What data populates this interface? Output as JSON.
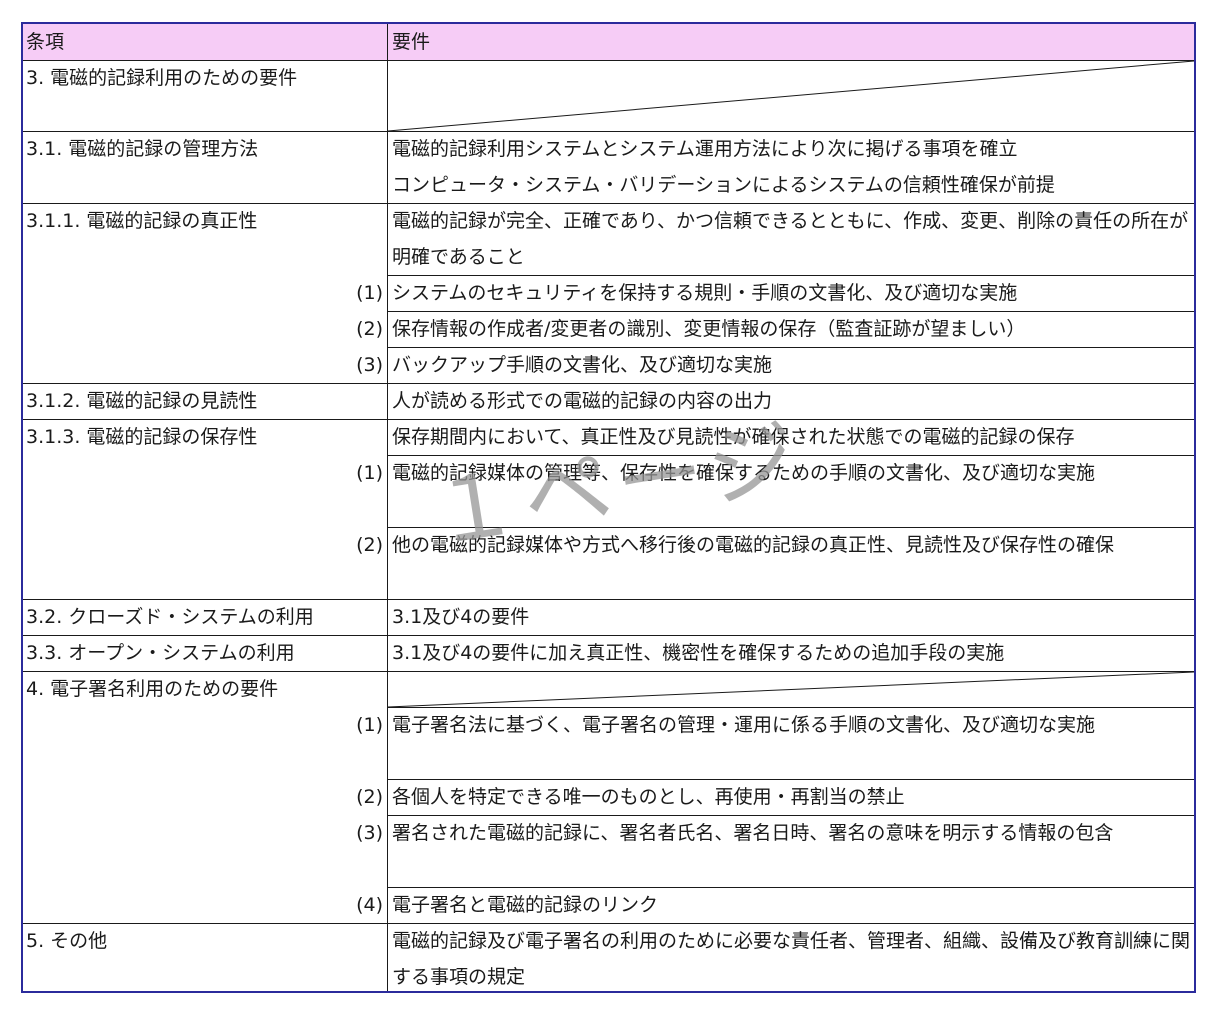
{
  "header": {
    "clause": "条項",
    "requirement": "要件"
  },
  "rows": {
    "r3": {
      "clause": "3. 電磁的記録利用のための要件"
    },
    "r31": {
      "clause": "3.1. 電磁的記録の管理方法",
      "line1": "電磁的記録利用システムとシステム運用方法により次に掲げる事項を確立",
      "line2": "コンピュータ・システム・バリデーションによるシステムの信頼性確保が前提"
    },
    "r311": {
      "clause": "3.1.1. 電磁的記録の真正性",
      "text": "電磁的記録が完全、正確であり、かつ信頼できるとともに、作成、変更、削除の責任の所在が明確であること",
      "sub": [
        {
          "num": "(1)",
          "text": "システムのセキュリティを保持する規則・手順の文書化、及び適切な実施"
        },
        {
          "num": "(2)",
          "text": "保存情報の作成者/変更者の識別、変更情報の保存（監査証跡が望ましい）"
        },
        {
          "num": "(3)",
          "text": "バックアップ手順の文書化、及び適切な実施"
        }
      ]
    },
    "r312": {
      "clause": "3.1.2. 電磁的記録の見読性",
      "text": "人が読める形式での電磁的記録の内容の出力"
    },
    "r313": {
      "clause": "3.1.3. 電磁的記録の保存性",
      "text": "保存期間内において、真正性及び見読性が確保された状態での電磁的記録の保存",
      "sub": [
        {
          "num": "(1)",
          "text": "電磁的記録媒体の管理等、保存性を確保するための手順の文書化、及び適切な実施"
        },
        {
          "num": "(2)",
          "text": "他の電磁的記録媒体や方式へ移行後の電磁的記録の真正性、見読性及び保存性の確保"
        }
      ]
    },
    "r32": {
      "clause": "3.2. クローズド・システムの利用",
      "text": "3.1及び4の要件"
    },
    "r33": {
      "clause": "3.3. オープン・システムの利用",
      "text": "3.1及び4の要件に加え真正性、機密性を確保するための追加手段の実施"
    },
    "r4": {
      "clause": "4. 電子署名利用のための要件",
      "sub": [
        {
          "num": "(1)",
          "text": "電子署名法に基づく、電子署名の管理・運用に係る手順の文書化、及び適切な実施"
        },
        {
          "num": "(2)",
          "text": "各個人を特定できる唯一のものとし、再使用・再割当の禁止"
        },
        {
          "num": "(3)",
          "text": "署名された電磁的記録に、署名者氏名、署名日時、署名の意味を明示する情報の包含"
        },
        {
          "num": "(4)",
          "text": "電子署名と電磁的記録のリンク"
        }
      ]
    },
    "r5": {
      "clause": "5. その他",
      "text": "電磁的記録及び電子署名の利用のために必要な責任者、管理者、組織、設備及び教育訓練に関する事項の規定"
    }
  },
  "watermark": "１ページ",
  "colors": {
    "header_bg": "#f6ccf6",
    "border": "#2b2b9c",
    "watermark": "#969696"
  }
}
